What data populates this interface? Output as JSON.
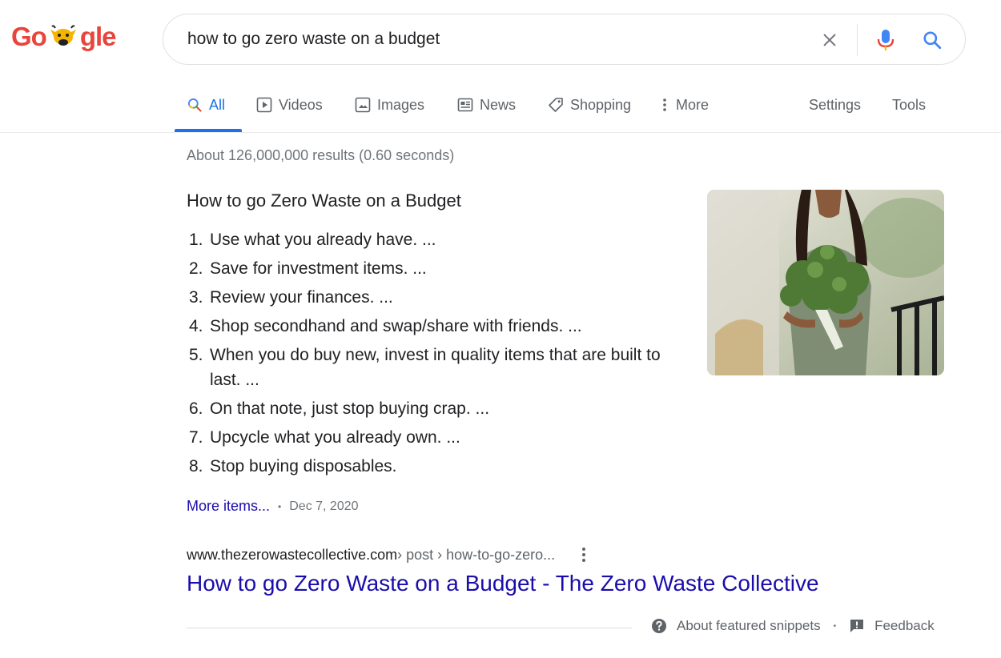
{
  "logo": {
    "left_text": "Go",
    "right_text": "gle"
  },
  "search": {
    "query": "how to go zero waste on a budget"
  },
  "tabs": [
    {
      "label": "All",
      "icon": "search-icon"
    },
    {
      "label": "Videos",
      "icon": "play-icon"
    },
    {
      "label": "Images",
      "icon": "image-icon"
    },
    {
      "label": "News",
      "icon": "news-icon"
    },
    {
      "label": "Shopping",
      "icon": "tag-icon"
    },
    {
      "label": "More",
      "icon": "more-vert-icon"
    }
  ],
  "tools": {
    "settings": "Settings",
    "tools": "Tools"
  },
  "result_stats": "About 126,000,000 results (0.60 seconds)",
  "snippet": {
    "title": "How to go Zero Waste on a Budget",
    "items": [
      {
        "num": "1.",
        "text": "Use what you already have. ..."
      },
      {
        "num": "2.",
        "text": "Save for investment items. ..."
      },
      {
        "num": "3.",
        "text": "Review your finances. ..."
      },
      {
        "num": "4.",
        "text": "Shop secondhand and swap/share with friends. ..."
      },
      {
        "num": "5.",
        "text": "When you do buy new, invest in quality items that are built to last. ..."
      },
      {
        "num": "6.",
        "text": "On that note, just stop buying crap. ..."
      },
      {
        "num": "7.",
        "text": "Upcycle what you already own. ..."
      },
      {
        "num": "8.",
        "text": "Stop buying disposables."
      }
    ],
    "more_items": "More items...",
    "date": "Dec 7, 2020"
  },
  "result": {
    "domain": "www.thezerowastecollective.com",
    "path": " › post › how-to-go-zero...",
    "title": "How to go Zero Waste on a Budget - The Zero Waste Collective"
  },
  "footer": {
    "about": "About featured snippets",
    "feedback": "Feedback"
  },
  "colors": {
    "accent": "#1a73e8",
    "link": "#1a0dab",
    "muted": "#70757a"
  }
}
